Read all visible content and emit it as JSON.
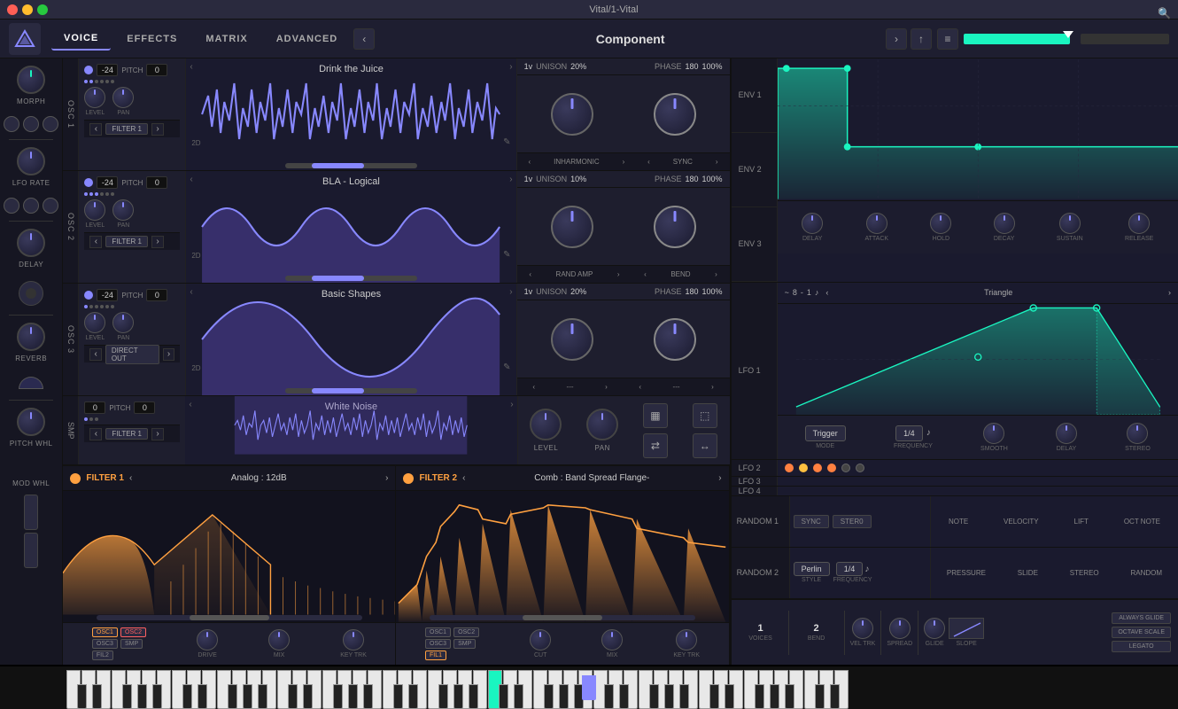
{
  "titlebar": {
    "title": "Vital/1-Vital"
  },
  "navbar": {
    "tabs": [
      "VOICE",
      "EFFECTS",
      "MATRIX",
      "ADVANCED"
    ],
    "active_tab": "VOICE",
    "preset_name": "Component",
    "arrow_left": "‹",
    "arrow_right": "›"
  },
  "oscillators": [
    {
      "id": "osc1",
      "label": "OSC 1",
      "pitch": "-24",
      "pitch_fine": "0",
      "waveform_name": "Drink the Juice",
      "waveform_type": "noise",
      "filter": "FILTER 1",
      "unison": "1v",
      "unison_pct": "20%",
      "phase": "180",
      "phase_pct": "100%",
      "mode": "INHARMONIC",
      "sync": "SYNC"
    },
    {
      "id": "osc2",
      "label": "OSC 2",
      "pitch": "-24",
      "pitch_fine": "0",
      "waveform_name": "BLA - Logical",
      "waveform_type": "wave",
      "filter": "FILTER 1",
      "unison": "1v",
      "unison_pct": "10%",
      "phase": "180",
      "phase_pct": "100%",
      "mode": "RAND AMP",
      "sync": "BEND"
    },
    {
      "id": "osc3",
      "label": "OSC 3",
      "pitch": "-24",
      "pitch_fine": "0",
      "waveform_name": "Basic Shapes",
      "waveform_type": "sine",
      "filter": "DIRECT OUT",
      "unison": "1v",
      "unison_pct": "20%",
      "phase": "180",
      "phase_pct": "100%",
      "mode": "---",
      "sync": "---"
    }
  ],
  "sampler": {
    "label": "SMP",
    "pitch": "0",
    "pitch_fine": "0",
    "waveform_name": "White Noise",
    "filter": "FILTER 1",
    "level_label": "LEVEL",
    "pan_label": "PAN"
  },
  "filters": [
    {
      "id": "filter1",
      "title": "FILTER 1",
      "preset": "Analog : 12dB",
      "type": "orange",
      "osc_sources": [
        "OSC1",
        "OSC2",
        "OSC3",
        "SMP"
      ],
      "active_sources": [
        "OSC1",
        "OSC2"
      ],
      "drive_label": "DRIVE",
      "mix_label": "MIX",
      "keytrk_label": "KEY TRK",
      "fil2_label": "FIL2"
    },
    {
      "id": "filter2",
      "title": "FILTER 2",
      "preset": "Comb : Band Spread Flange-",
      "type": "orange",
      "cut_label": "CUT",
      "mix_label": "MIX",
      "keytrk_label": "KEY TRK",
      "fil1_label": "FIL1"
    }
  ],
  "env": {
    "sections": [
      "ENV 1",
      "ENV 2",
      "ENV 3"
    ],
    "knobs": [
      "DELAY",
      "ATTACK",
      "HOLD",
      "DECAY",
      "SUSTAIN",
      "RELEASE"
    ]
  },
  "lfo": {
    "sections": [
      "LFO 1",
      "LFO 2",
      "LFO 3",
      "LFO 4"
    ],
    "lfo1": {
      "time_num": "8",
      "time_denom": "1",
      "waveform_name": "Triangle",
      "mode_label": "MODE",
      "freq_label": "FREQUENCY",
      "smooth_label": "SMOOTH",
      "delay_label": "DELAY",
      "stereo_label": "STEREO",
      "mode_val": "Trigger",
      "freq_val": "1/4"
    }
  },
  "random": {
    "sections": [
      "RANDOM 1",
      "RANDOM 2"
    ],
    "random1": {
      "sync_btn": "SYNC",
      "stereo_btn": "STER0",
      "right_labels": [
        "NOTE",
        "VELOCITY",
        "LIFT",
        "OCT NOTE"
      ]
    },
    "random2": {
      "style": "Perlin",
      "style_label": "STYLE",
      "frequency": "1/4",
      "freq_label": "FREQUENCY",
      "right_labels": [
        "PRESSURE",
        "SLIDE",
        "STEREO",
        "RANDOM"
      ]
    }
  },
  "voice": {
    "voices_val": "1",
    "voices_label": "VOICES",
    "bend_val": "2",
    "bend_label": "BEND",
    "vel_trk_label": "VEL TRK",
    "spread_label": "SPREAD",
    "glide_label": "GLIDE",
    "slope_label": "SLOPE",
    "glide_options": [
      "ALWAYS GLIDE",
      "OCTAVE SCALE",
      "LEGATO"
    ]
  },
  "icons": {
    "logo": "V",
    "search": "🔍",
    "pencil": "✎",
    "bars": "≡",
    "arrow_up": "↑",
    "arrow_down": "↓"
  },
  "colors": {
    "accent_purple": "#8888ff",
    "accent_teal": "#1af5c0",
    "accent_orange": "#ffa040",
    "bg_dark": "#1a1a2e",
    "bg_mid": "#1e1e2e",
    "bg_darker": "#161622"
  }
}
